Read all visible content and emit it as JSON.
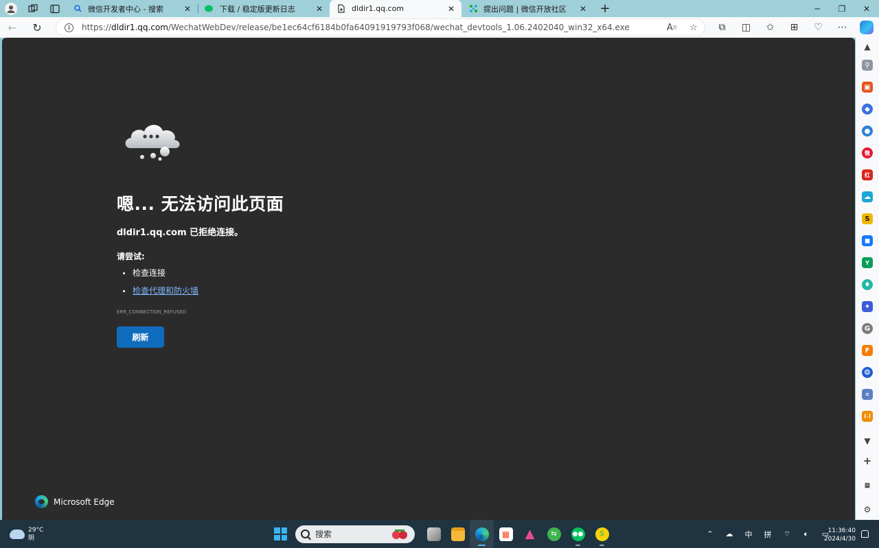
{
  "browser": {
    "tabs": [
      {
        "title": "微信开发者中心 - 搜索",
        "favicon_color": "#2563eb",
        "active": false
      },
      {
        "title": "下载 / 稳定版更新日志",
        "favicon_color": "#07c160",
        "active": false
      },
      {
        "title": "dldir1.qq.com",
        "favicon_color": "#333333",
        "active": true
      },
      {
        "title": "提出问题 | 微信开放社区",
        "favicon_color": "#1aad19",
        "active": false
      }
    ],
    "new_tab_glyph": "+",
    "address": {
      "url_prefix": "https://",
      "url_host": "dldir1.qq.com",
      "url_path": "/WechatWebDev/release/be1ec64cf6184b0fa64091919793f068/wechat_devtools_1.06.2402040_win32_x64.exe"
    }
  },
  "error_page": {
    "title": "嗯... 无法访问此页面",
    "host": "dldir1.qq.com",
    "host_suffix": " 已拒绝连接。",
    "try_heading": "请尝试:",
    "suggestions": [
      {
        "text": "检查连接",
        "link": false
      },
      {
        "text": "检查代理和防火墙",
        "link": true
      }
    ],
    "error_code": "ERR_CONNECTION_REFUSED",
    "refresh_label": "刷新",
    "brand": "Microsoft Edge"
  },
  "sidebar": {
    "items": [
      {
        "icon": "search-icon",
        "color": "#555555",
        "glyph": "⚲"
      },
      {
        "icon": "toolbox-icon",
        "color": "#e8531f",
        "glyph": "▣"
      },
      {
        "icon": "copilot-icon",
        "color": "#3a6fe0",
        "glyph": "◆"
      },
      {
        "icon": "drop-icon",
        "color": "#2b7fd8",
        "glyph": "●"
      },
      {
        "icon": "weibo-icon",
        "color": "#e6162d",
        "glyph": "微"
      },
      {
        "icon": "red-app-icon",
        "color": "#d9261c",
        "glyph": "红"
      },
      {
        "icon": "cloud-app-icon",
        "color": "#1aa6d6",
        "glyph": "☁"
      },
      {
        "icon": "yellow-app-icon",
        "color": "#f2b705",
        "glyph": "S"
      },
      {
        "icon": "box-app-icon",
        "color": "#1677ff",
        "glyph": "◼"
      },
      {
        "icon": "green-app-icon",
        "color": "#0a9d58",
        "glyph": "Y"
      },
      {
        "icon": "cyan-app-icon",
        "color": "#22b8a7",
        "glyph": "♦"
      },
      {
        "icon": "puzzle-app-icon",
        "color": "#3b5bdb",
        "glyph": "✦"
      },
      {
        "icon": "g-app-icon",
        "color": "#7c7c7c",
        "glyph": "G"
      },
      {
        "icon": "orange-app-icon",
        "color": "#f57c00",
        "glyph": "F"
      },
      {
        "icon": "blue-gear-app-icon",
        "color": "#1f5fd1",
        "glyph": "❂"
      },
      {
        "icon": "text-app-icon",
        "color": "#5b7fc2",
        "glyph": "≡"
      },
      {
        "icon": "bracket-app-icon",
        "color": "#f08c00",
        "glyph": "[-]"
      }
    ]
  },
  "taskbar": {
    "weather": {
      "temp": "29°C",
      "condition": "阴"
    },
    "search_placeholder": "搜索",
    "ime_lang": "中",
    "ime_mode": "拼",
    "time": "11:36:40",
    "date": "2024/4/30"
  }
}
